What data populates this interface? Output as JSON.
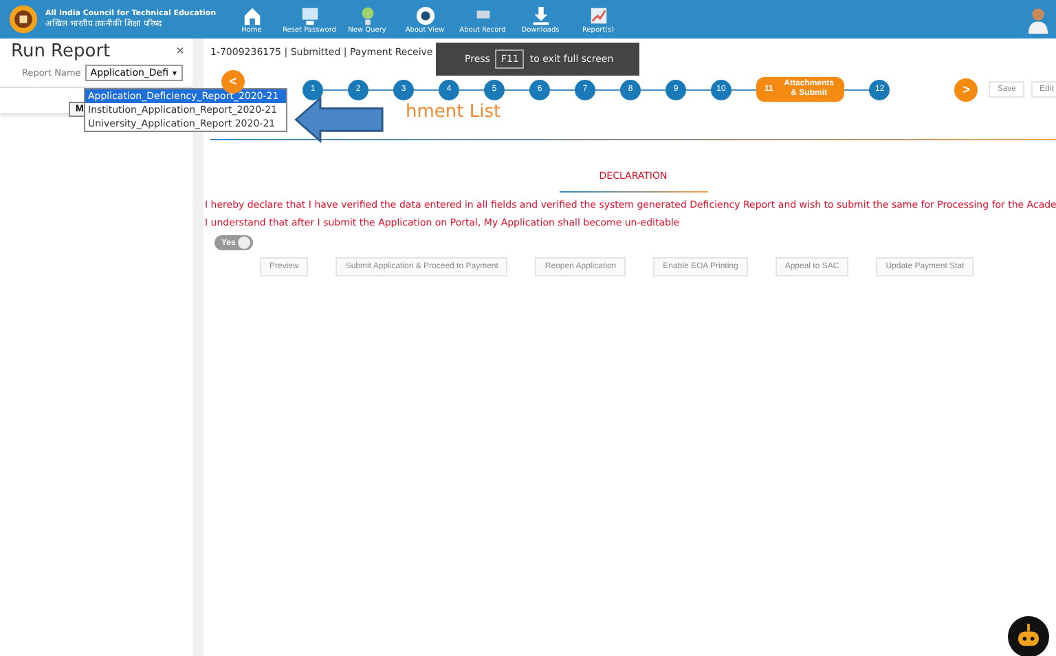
{
  "header": {
    "org_name": "All India Council for Technical Education",
    "org_name_hindi": "अखिल भारतीय तकनीकी शिक्षा परिषद",
    "nav": [
      {
        "label": "Home"
      },
      {
        "label": "Reset Password"
      },
      {
        "label": "New Query"
      },
      {
        "label": "About View"
      },
      {
        "label": "About Record"
      },
      {
        "label": "Downloads"
      },
      {
        "label": "Report(s)"
      }
    ]
  },
  "report_panel": {
    "title": "Run Report",
    "close": "×",
    "field_label": "Report Name",
    "select_value": "Application_Defi",
    "select_caret": "▾",
    "button_label": "M",
    "options": [
      {
        "label": "Application_Deficiency_Report_2020-21",
        "selected": true
      },
      {
        "label": "Institution_Application_Report_2020-21",
        "selected": false
      },
      {
        "label": "University_Application_Report 2020-21",
        "selected": false
      }
    ]
  },
  "main": {
    "status_line": "1-7009236175 | Submitted | Payment Receive",
    "prev": "<",
    "next": ">",
    "steps": [
      {
        "number": "1",
        "selected": false
      },
      {
        "number": "2",
        "selected": false
      },
      {
        "number": "3",
        "selected": false
      },
      {
        "number": "4",
        "selected": false
      },
      {
        "number": "5",
        "selected": false
      },
      {
        "number": "6",
        "selected": false
      },
      {
        "number": "7",
        "selected": false
      },
      {
        "number": "8",
        "selected": false
      },
      {
        "number": "9",
        "selected": false
      },
      {
        "number": "10",
        "selected": false
      },
      {
        "number": "11",
        "label": "Attachments & Submit",
        "selected": true
      },
      {
        "number": "12",
        "selected": false
      }
    ],
    "actions": [
      {
        "label": "Save",
        "disabled": true
      },
      {
        "label": "Edit",
        "disabled": true
      }
    ],
    "heading": "hment List",
    "section_title": "DECLARATION",
    "declaration": [
      "I hereby declare that I have verified the data entered in all fields and verified the system generated Deficiency Report and wish to submit the same for Processing for the Acade",
      "I understand that after I submit the Application on Portal, My Application shall become un-editable"
    ],
    "toggle": {
      "label": "Yes",
      "on": true
    },
    "buttons": [
      {
        "label": "Preview",
        "disabled": true
      },
      {
        "label": "Submit Application & Proceed to Payment",
        "disabled": true
      },
      {
        "label": "Reopen Application",
        "disabled": true
      },
      {
        "label": "Enable EOA Printing",
        "disabled": true
      },
      {
        "label": "Appeal to SAC",
        "disabled": true
      },
      {
        "label": "Update Payment Stat",
        "disabled": true
      }
    ]
  },
  "toast": {
    "before": "Press",
    "key": "F11",
    "after": "to exit full screen"
  }
}
